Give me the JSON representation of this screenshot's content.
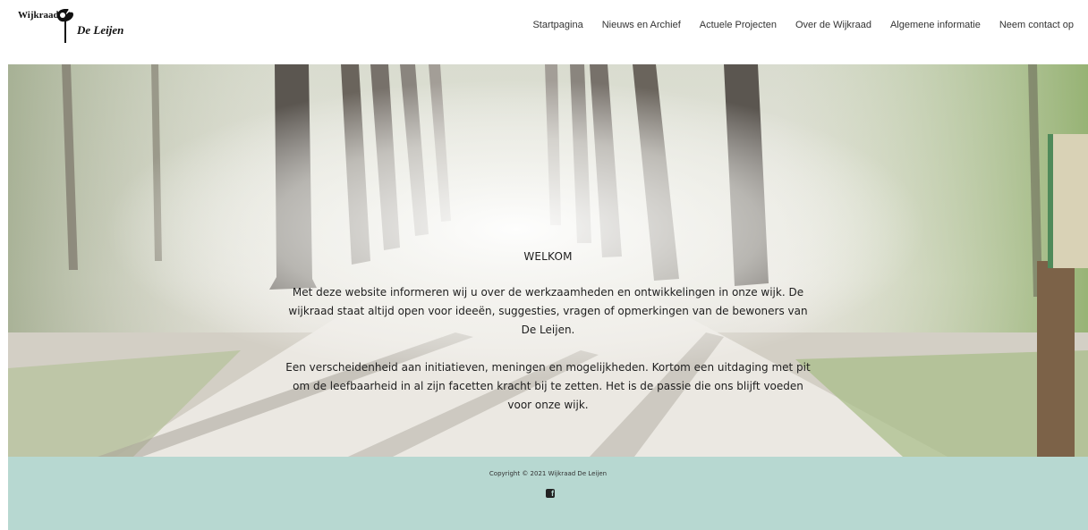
{
  "logo": {
    "top_text": "Wijkraad",
    "bottom_text": "De Leijen"
  },
  "nav": {
    "items": [
      {
        "label": "Startpagina"
      },
      {
        "label": "Nieuws en Archief"
      },
      {
        "label": "Actuele Projecten"
      },
      {
        "label": "Over de Wijkraad"
      },
      {
        "label": "Algemene informatie"
      },
      {
        "label": "Neem contact op"
      }
    ]
  },
  "hero": {
    "title": "WELKOM",
    "paragraph1": "Met deze website informeren wij u over de werkzaamheden en ontwikkelingen in onze wijk. De wijkraad staat altijd open voor ideeën, suggesties, vragen of opmerkingen van de bewoners van De Leijen.",
    "paragraph2": "Een verscheidenheid aan initiatieven, meningen en mogelijkheden. Kortom een uitdaging met pit om de leefbaarheid in al zijn facetten kracht bij te zetten. Het is de passie die ons blijft voeden voor onze wijk.",
    "background_icon": "forest-path-image"
  },
  "footer": {
    "copyright": "Copyright © 2021 Wijkraad De Leijen",
    "social_icon": "facebook-icon",
    "background_color": "#b7d8d1"
  }
}
